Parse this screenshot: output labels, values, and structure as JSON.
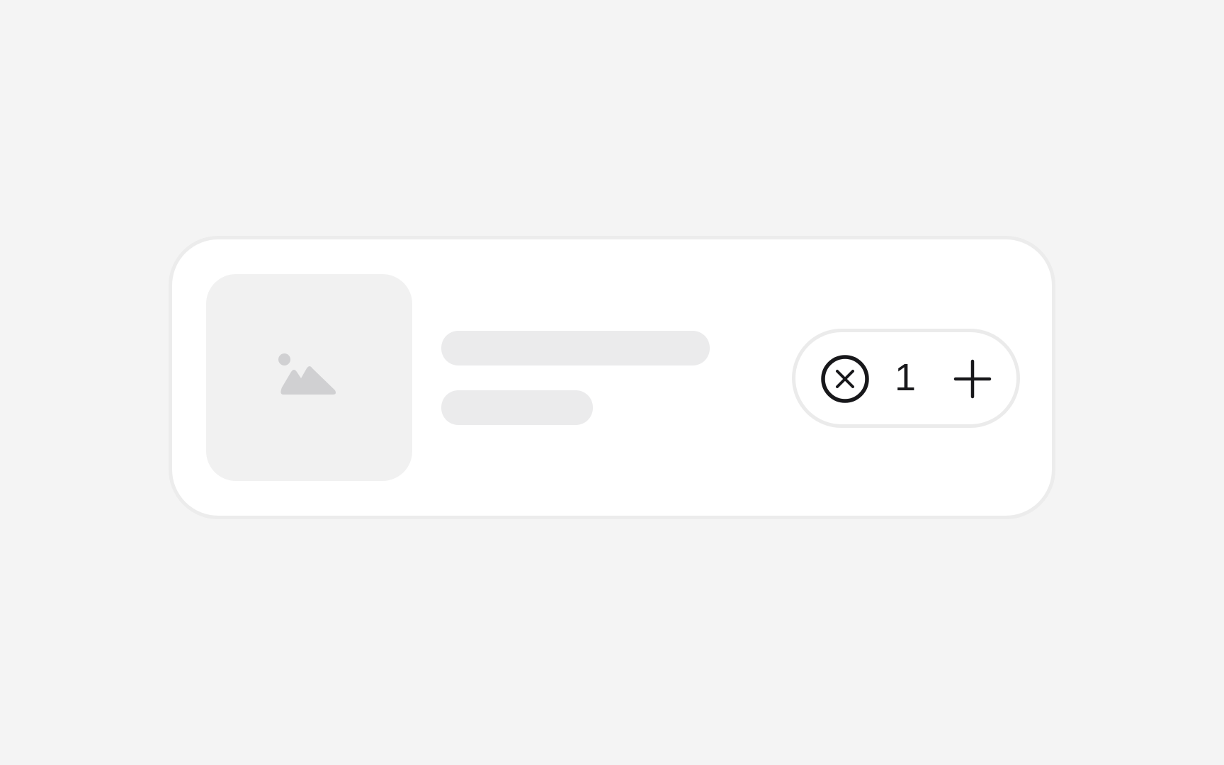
{
  "cart_item": {
    "quantity": "1",
    "icons": {
      "thumbnail": "image-placeholder-icon",
      "remove": "x-circle-icon",
      "add": "plus-icon"
    }
  },
  "colors": {
    "page_background": "#f4f4f4",
    "card_background": "#ffffff",
    "card_border": "#ececec",
    "thumbnail_background": "#f1f1f1",
    "skeleton": "#ebebec",
    "icon_placeholder": "#d0d0d2",
    "icon_foreground": "#18181b"
  }
}
